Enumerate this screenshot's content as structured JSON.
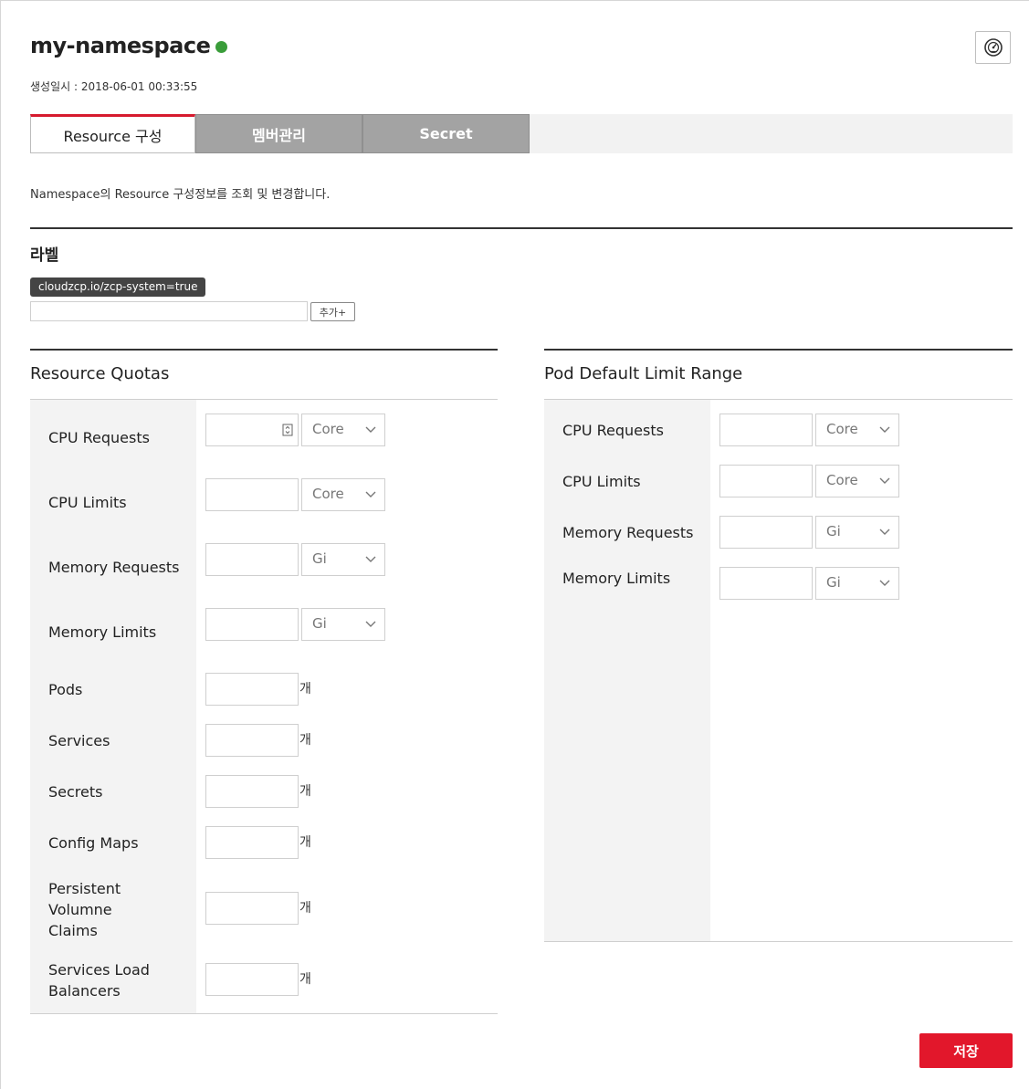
{
  "header": {
    "namespace_name": "my-namespace",
    "status_color": "#3a9d3a",
    "created_label": "생성일시 : 2018-06-01 00:33:55",
    "icon_button": "dashboard-gauge-icon"
  },
  "tabs": [
    {
      "label": "Resource 구성",
      "active": true
    },
    {
      "label": "멤버관리",
      "active": false
    },
    {
      "label": "Secret",
      "active": false
    }
  ],
  "description": "Namespace의 Resource 구성정보를 조회 및 변경합니다.",
  "labels": {
    "title": "라벨",
    "chips": [
      "cloudzcp.io/zcp-system=true"
    ],
    "input_value": "",
    "add_button": "추가+"
  },
  "resource_quotas": {
    "title": "Resource Quotas",
    "rows": [
      {
        "label": "CPU Requests",
        "value": "",
        "select": "Core"
      },
      {
        "label": "CPU Limits",
        "value": "",
        "select": "Core"
      },
      {
        "label": "Memory Requests",
        "value": "",
        "select": "Gi"
      },
      {
        "label": "Memory Limits",
        "value": "",
        "select": "Gi"
      },
      {
        "label": "Pods",
        "value": "",
        "unit": "개"
      },
      {
        "label": "Services",
        "value": "",
        "unit": "개"
      },
      {
        "label": "Secrets",
        "value": "",
        "unit": "개"
      },
      {
        "label": "Config Maps",
        "value": "",
        "unit": "개"
      },
      {
        "label": "Persistent Volumne Claims",
        "value": "",
        "unit": "개"
      },
      {
        "label": "Services Load Balancers",
        "value": "",
        "unit": "개"
      }
    ]
  },
  "pod_limit_range": {
    "title": "Pod Default Limit Range",
    "rows": [
      {
        "label": "CPU Requests",
        "value": "",
        "select": "Core"
      },
      {
        "label": "CPU Limits",
        "value": "",
        "select": "Core"
      },
      {
        "label": "Memory Requests",
        "value": "",
        "select": "Gi"
      },
      {
        "label": "Memory Limits",
        "value": "",
        "select": "Gi"
      }
    ]
  },
  "save_button": "저장",
  "accent_color": "#e2172b"
}
